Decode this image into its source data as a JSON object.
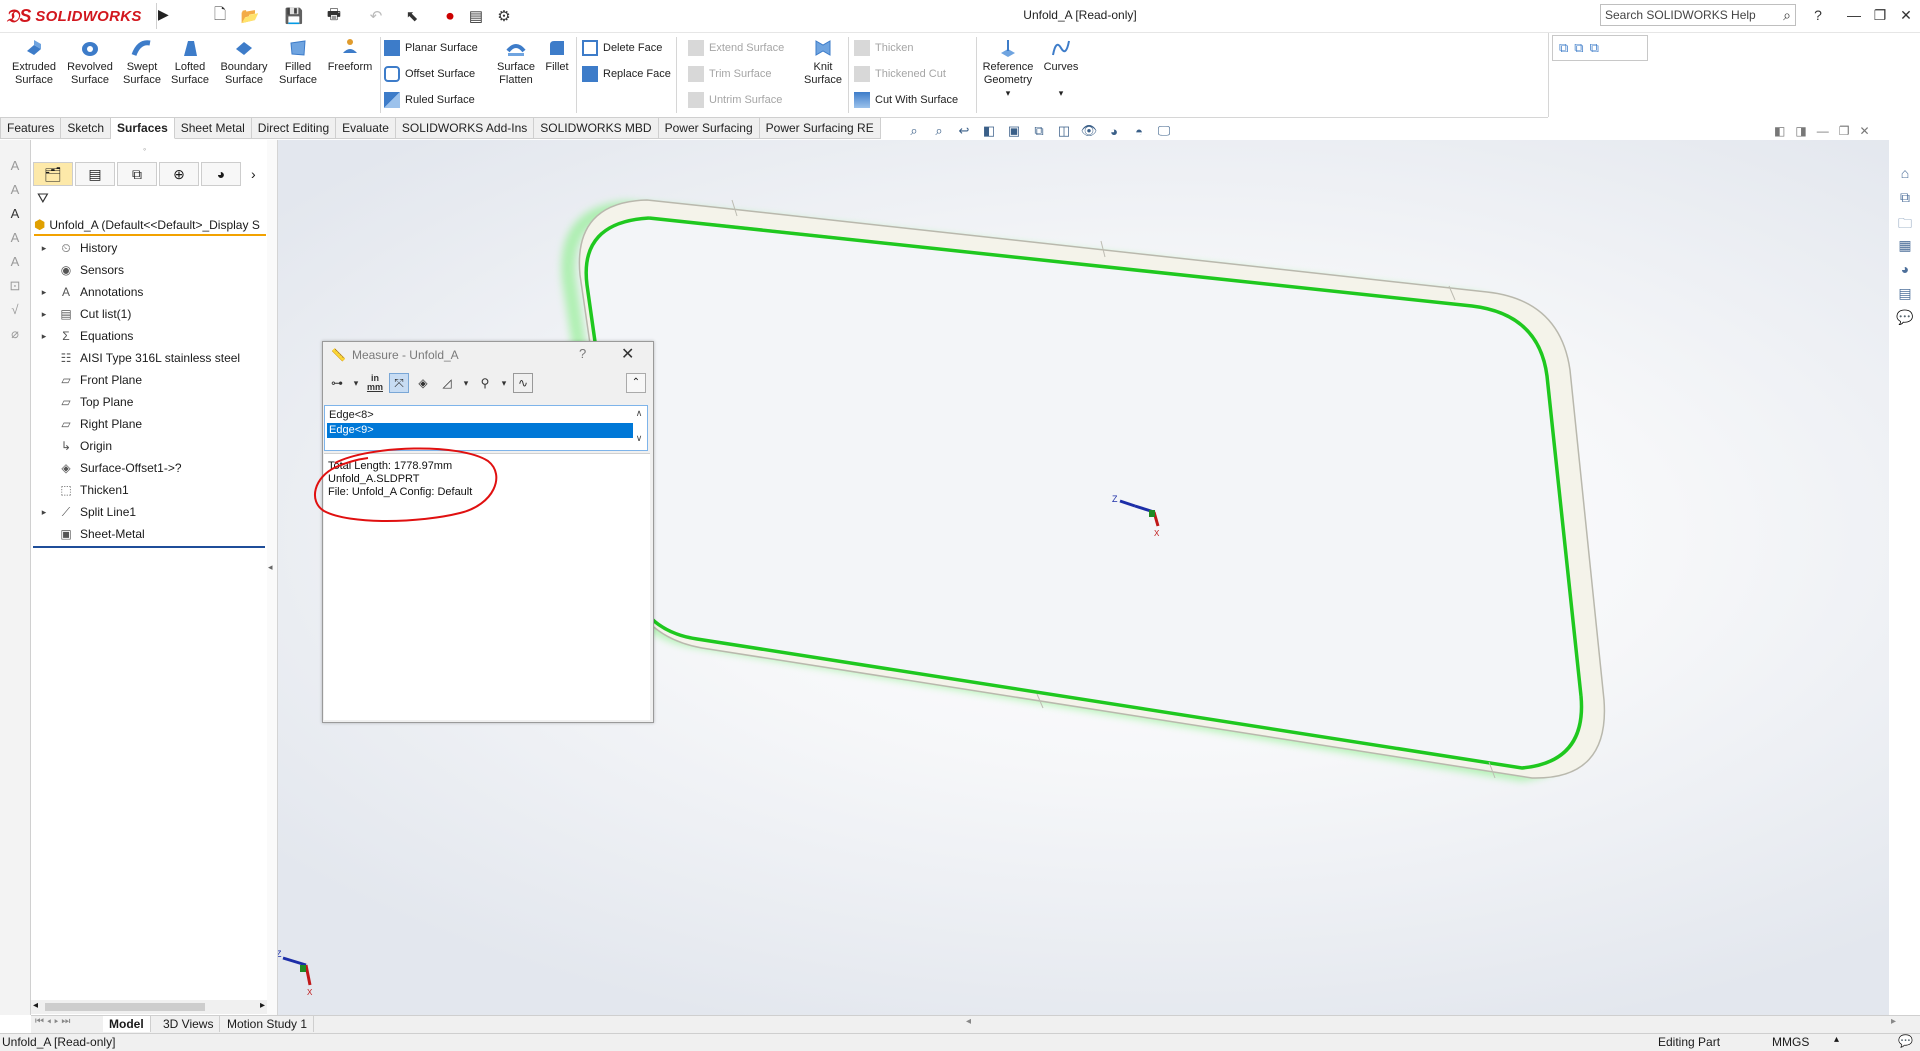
{
  "app": {
    "brand": "SOLIDWORKS",
    "document_title": "Unfold_A [Read-only]",
    "search_placeholder": "Search SOLIDWORKS Help"
  },
  "ribbon": {
    "big_buttons": [
      {
        "label": "Extruded Surface",
        "icon": "extruded-surface-icon"
      },
      {
        "label": "Revolved Surface",
        "icon": "revolved-surface-icon"
      },
      {
        "label": "Swept Surface",
        "icon": "swept-surface-icon"
      },
      {
        "label": "Lofted Surface",
        "icon": "lofted-surface-icon"
      },
      {
        "label": "Boundary Surface",
        "icon": "boundary-surface-icon"
      },
      {
        "label": "Filled Surface",
        "icon": "filled-surface-icon"
      },
      {
        "label": "Freeform",
        "icon": "freeform-icon"
      }
    ],
    "surface_group": [
      "Planar Surface",
      "Offset Surface",
      "Ruled Surface"
    ],
    "flatten": "Surface Flatten",
    "fillet": "Fillet",
    "face_group": [
      "Delete Face",
      "Replace Face"
    ],
    "disabled_group": [
      "Extend Surface",
      "Trim Surface",
      "Untrim Surface"
    ],
    "knit": "Knit Surface",
    "thicken_group": [
      "Thicken",
      "Thickened Cut",
      "Cut With Surface"
    ],
    "reference_geometry": "Reference Geometry",
    "curves": "Curves"
  },
  "tabs": [
    "Features",
    "Sketch",
    "Surfaces",
    "Sheet Metal",
    "Direct Editing",
    "Evaluate",
    "SOLIDWORKS Add-Ins",
    "SOLIDWORKS MBD",
    "Power Surfacing",
    "Power Surfacing RE"
  ],
  "active_tab": "Surfaces",
  "feature_tree": {
    "root": "Unfold_A  (Default<<Default>_Display S",
    "items": [
      {
        "label": "History",
        "icon": "history-icon",
        "expandable": true
      },
      {
        "label": "Sensors",
        "icon": "sensors-icon",
        "expandable": false
      },
      {
        "label": "Annotations",
        "icon": "annotations-icon",
        "expandable": true
      },
      {
        "label": "Cut list(1)",
        "icon": "cut-list-icon",
        "expandable": true
      },
      {
        "label": "Equations",
        "icon": "equations-icon",
        "expandable": true
      },
      {
        "label": "AISI Type 316L stainless steel",
        "icon": "material-icon",
        "expandable": false
      },
      {
        "label": "Front Plane",
        "icon": "plane-icon",
        "expandable": false
      },
      {
        "label": "Top Plane",
        "icon": "plane-icon",
        "expandable": false
      },
      {
        "label": "Right Plane",
        "icon": "plane-icon",
        "expandable": false
      },
      {
        "label": "Origin",
        "icon": "origin-icon",
        "expandable": false
      },
      {
        "label": "Surface-Offset1->?",
        "icon": "surface-offset-icon",
        "expandable": false
      },
      {
        "label": "Thicken1",
        "icon": "thicken-icon",
        "expandable": false
      },
      {
        "label": "Split Line1",
        "icon": "split-line-icon",
        "expandable": true
      },
      {
        "label": "Sheet-Metal",
        "icon": "sheet-metal-icon",
        "expandable": false
      }
    ]
  },
  "measure": {
    "title": "Measure - Unfold_A",
    "help": "?",
    "unit_button_top": "in",
    "unit_button_bottom": "mm",
    "selections": [
      "Edge<8>",
      "Edge<9>"
    ],
    "selected_index": 1,
    "results": [
      "Total Length: 1778.97mm",
      "Unfold_A.SLDPRT",
      "File: Unfold_A Config: Default"
    ]
  },
  "bottom_tabs": [
    "Model",
    "3D Views",
    "Motion Study 1"
  ],
  "active_bottom_tab": "Model",
  "status": {
    "left": "Unfold_A [Read-only]",
    "mode": "Editing Part",
    "units": "MMGS"
  },
  "colors": {
    "brand_red": "#d2171e",
    "selection_blue": "#0078d7",
    "edge_highlight_green": "#1fc81f",
    "annotation_red": "#e01010",
    "tree_accent": "#f2a200"
  }
}
